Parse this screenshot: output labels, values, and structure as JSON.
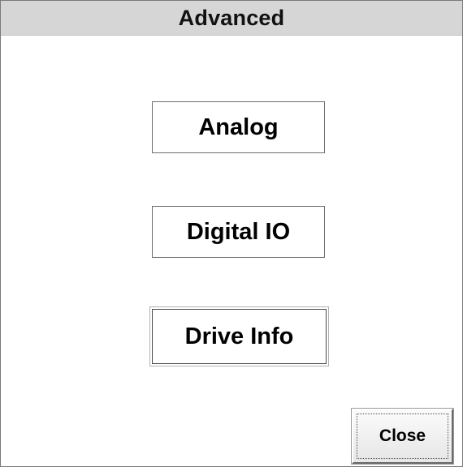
{
  "dialog": {
    "title": "Advanced"
  },
  "buttons": {
    "analog": "Analog",
    "digital_io": "Digital IO",
    "drive_info": "Drive Info"
  },
  "footer": {
    "close_label": "Close"
  },
  "colors": {
    "title_bar": "#d6d6d6",
    "background": "#ffffff",
    "button_border": "#6e6e6e",
    "text": "#000000"
  }
}
